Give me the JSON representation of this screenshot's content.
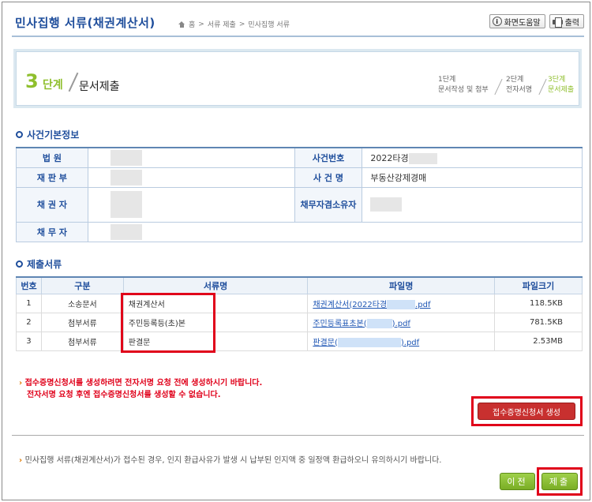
{
  "header": {
    "title": "민사집행 서류(채권계산서)",
    "breadcrumb": [
      "홈",
      ">",
      "서류 제출",
      ">",
      "민사집행 서류"
    ],
    "help_button": "화면도움말",
    "print_button": "출력"
  },
  "steps": {
    "current_number": "3",
    "current_unit": "단계",
    "current_label": "문서제출",
    "items": [
      {
        "num": "1단계",
        "label": "문서작성 및 첨부",
        "active": false
      },
      {
        "num": "2단계",
        "label": "전자서명",
        "active": false
      },
      {
        "num": "3단계",
        "label": "문서제출",
        "active": true
      }
    ]
  },
  "case_info": {
    "heading": "사건기본정보",
    "labels": {
      "court": "법 원",
      "panel": "재 판 부",
      "creditor": "채 권 자",
      "debtor": "채 무 자",
      "case_no": "사건번호",
      "case_name": "사 건 명",
      "owner": "채무자겸소유자"
    },
    "values": {
      "case_no": "2022타경",
      "case_name": "부동산강제경매"
    }
  },
  "files": {
    "heading": "제출서류",
    "columns": [
      "번호",
      "구분",
      "서류명",
      "파일명",
      "파일크기"
    ],
    "rows": [
      {
        "no": "1",
        "type": "소송문서",
        "doc": "채권계산서",
        "file_pre": "채권계산서(2022타경",
        "file_post": ".pdf",
        "size": "118.5KB"
      },
      {
        "no": "2",
        "type": "첨부서류",
        "doc": "주민등록등(초)본",
        "file_pre": "주민등록표초본(",
        "file_post": ").pdf",
        "size": "781.5KB"
      },
      {
        "no": "3",
        "type": "첨부서류",
        "doc": "판결문",
        "file_pre": "판결문(",
        "file_post": ").pdf",
        "size": "2.53MB"
      }
    ]
  },
  "warning": {
    "line1": "접수증명신청서를 생성하려면 전자서명 요청 전에 생성하시기 바랍니다.",
    "line2": "전자서명 요청 후엔 접수증명신청서를 생성할 수 없습니다."
  },
  "receipt_button": "접수증명신청서 생성",
  "notice": "민사집행 서류(채권계산서)가 접수된 경우, 인지 환급사유가 발생 시 납부된 인지액 중 일정액 환급하오니 유의하시기 바랍니다.",
  "buttons": {
    "prev": "이전",
    "submit": "제출"
  },
  "colors": {
    "title_blue": "#1f4e9c",
    "step_green": "#8fbf2d",
    "warn_red": "#e0001a",
    "highlight_red": "#e0001a"
  }
}
